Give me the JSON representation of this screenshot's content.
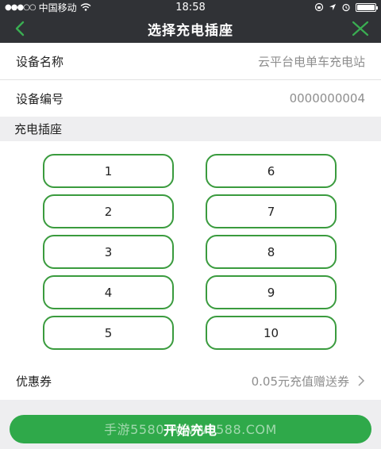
{
  "status_bar": {
    "signal_dots": "●●●○○",
    "carrier": "中国移动",
    "time": "18:58"
  },
  "nav": {
    "title": "选择充电插座",
    "back_icon": "chevron-left-icon",
    "close_icon": "close-icon"
  },
  "device": {
    "name_label": "设备名称",
    "name_value": "云平台电单车充电站",
    "id_label": "设备编号",
    "id_value": "0000000004"
  },
  "sockets": {
    "section_title": "充电插座",
    "items": [
      "1",
      "2",
      "3",
      "4",
      "5",
      "6",
      "7",
      "8",
      "9",
      "10"
    ]
  },
  "coupon": {
    "label": "优惠券",
    "value": "0.05元充值赠送券"
  },
  "start_button": "开始充电",
  "watermark": "手游5580  WWW5588.COM",
  "colors": {
    "header_bg": "#303236",
    "accent_green": "#3a9b3e",
    "button_green": "#2fa94a"
  }
}
